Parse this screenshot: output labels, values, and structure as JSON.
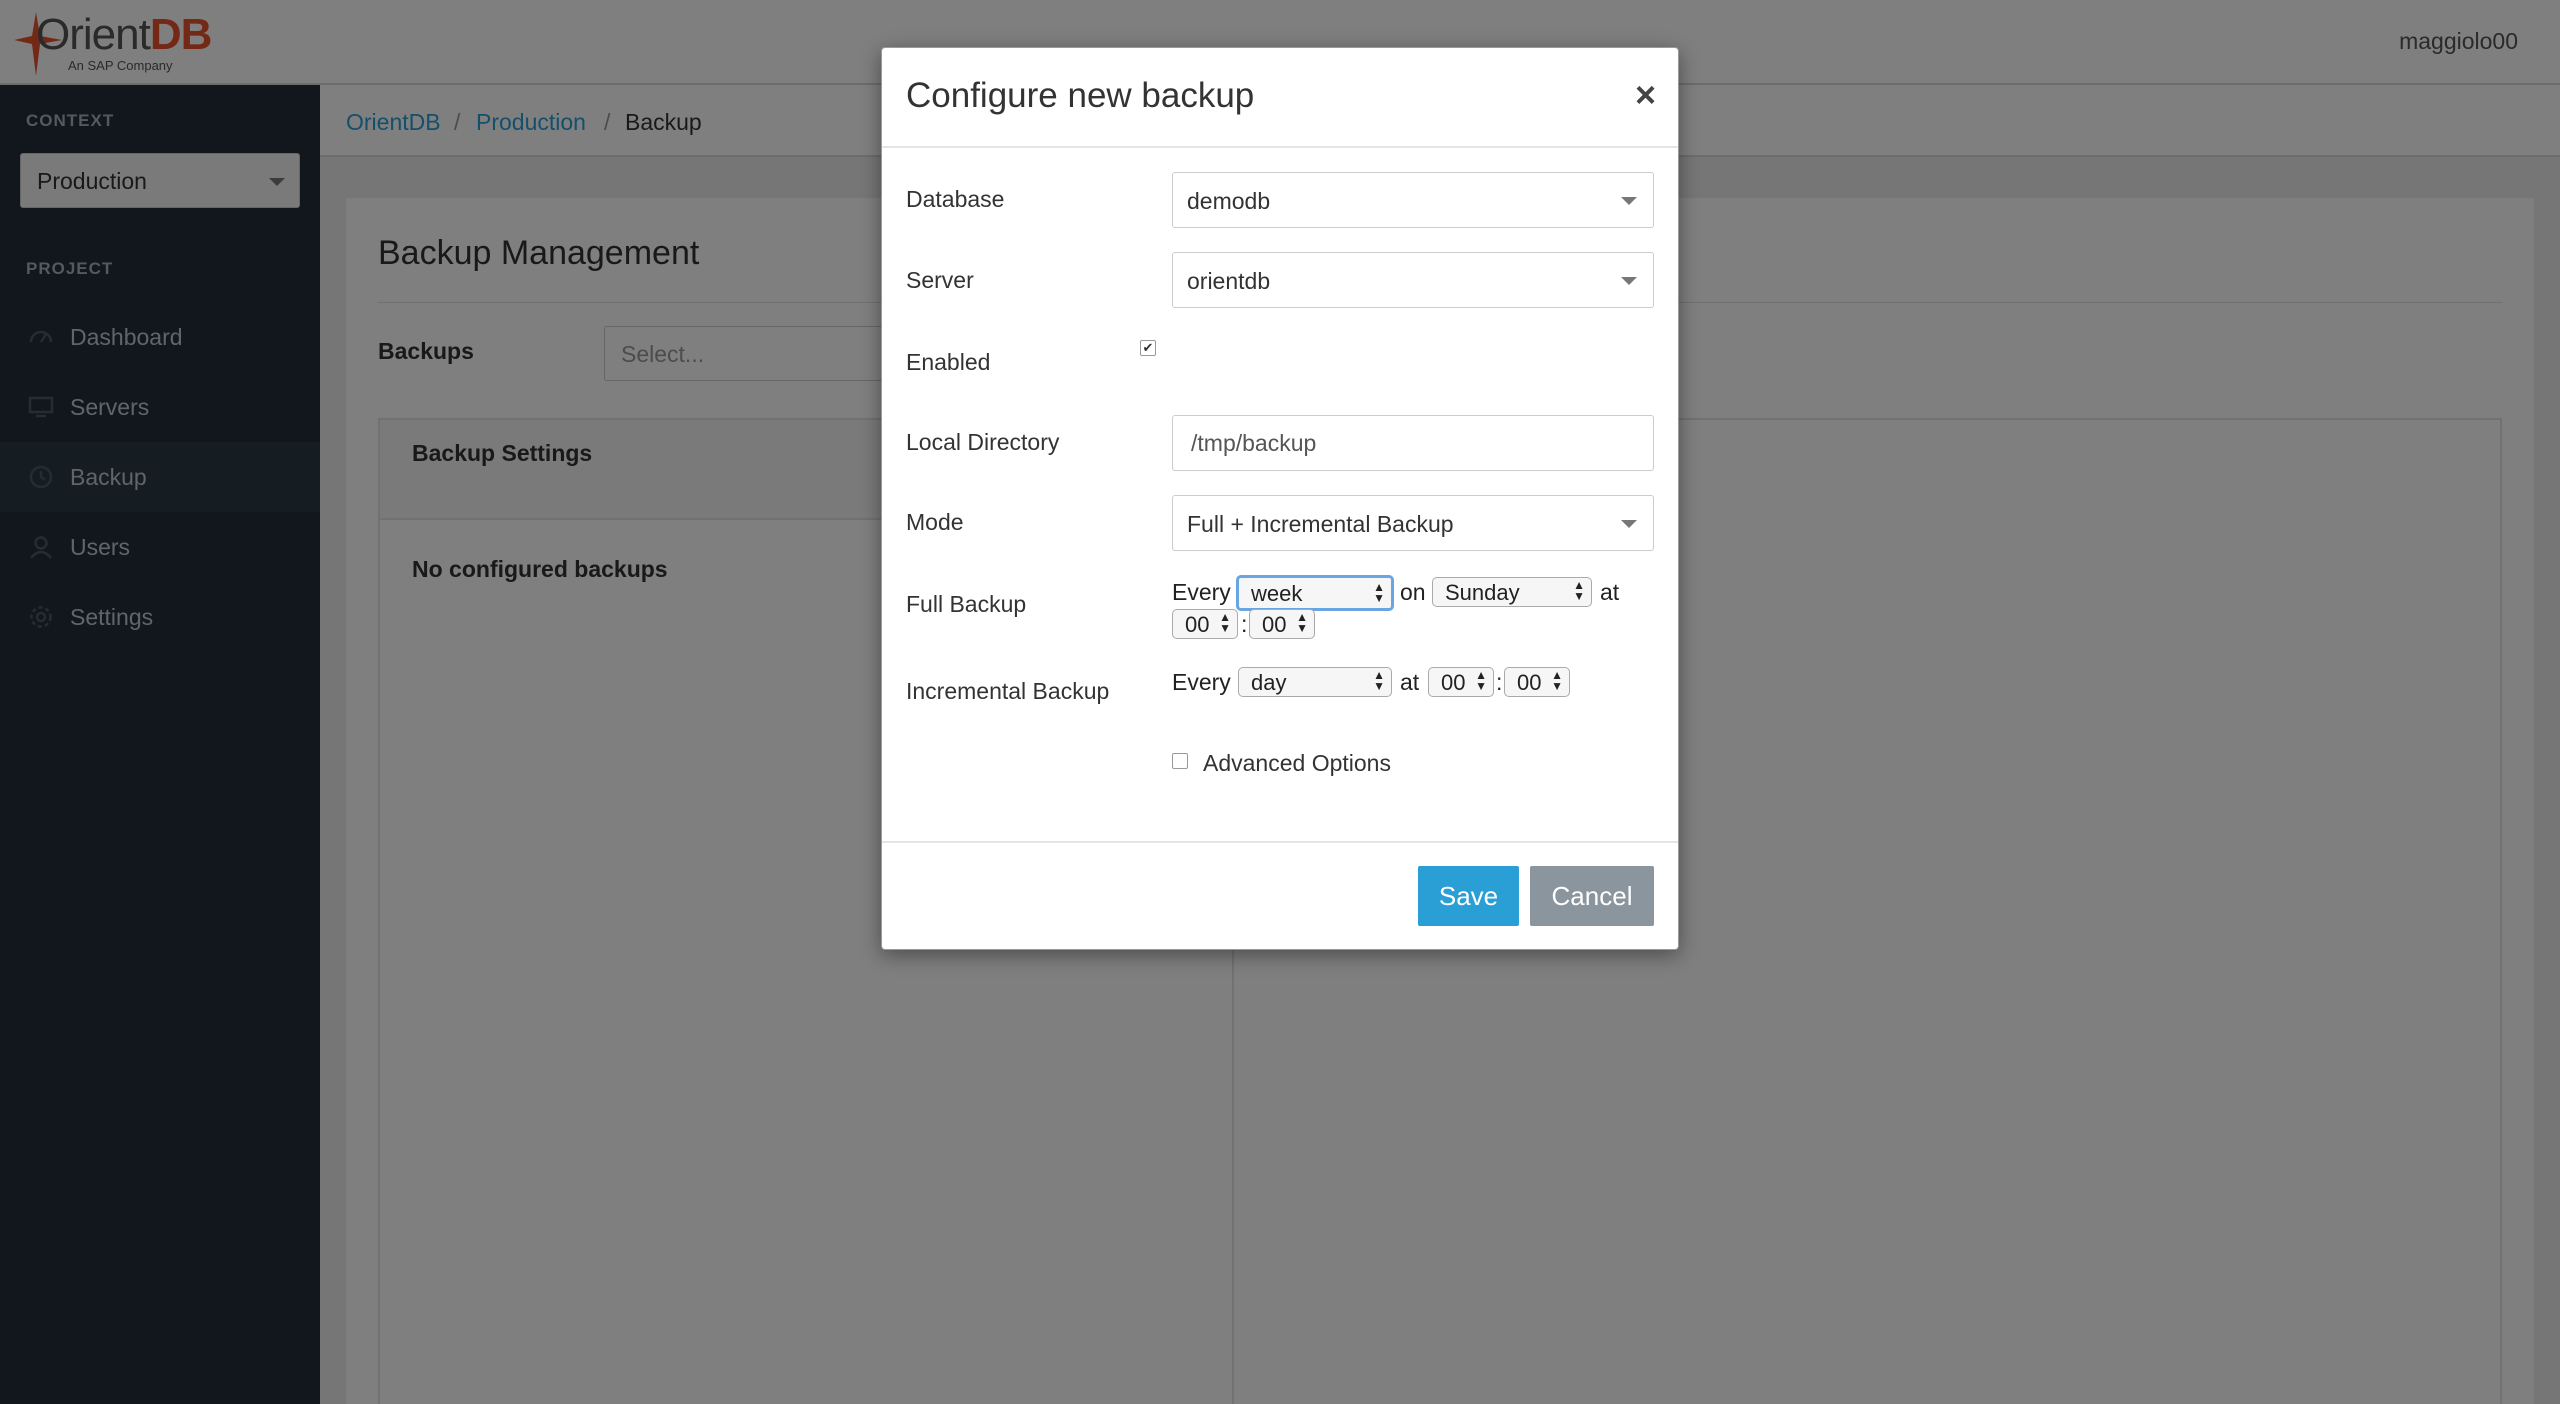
{
  "header": {
    "logo_text_orient": "Orient",
    "logo_text_db": "DB",
    "logo_sub": "An SAP Company",
    "username": "maggiolo00"
  },
  "sidebar": {
    "context_heading": "CONTEXT",
    "context_value": "Production",
    "project_heading": "PROJECT",
    "items": [
      {
        "label": "Dashboard",
        "icon": "dashboard-icon"
      },
      {
        "label": "Servers",
        "icon": "monitor-icon"
      },
      {
        "label": "Backup",
        "icon": "clock-icon",
        "active": true
      },
      {
        "label": "Users",
        "icon": "user-icon"
      },
      {
        "label": "Settings",
        "icon": "gear-icon"
      }
    ]
  },
  "breadcrumb": {
    "items": [
      "OrientDB",
      "Production",
      "Backup"
    ],
    "separator": "/"
  },
  "main": {
    "title": "Backup Management",
    "backups_label": "Backups",
    "backups_placeholder": "Select...",
    "settings_panel_title": "Backup Settings",
    "empty_message": "No configured backups"
  },
  "modal": {
    "title": "Configure new backup",
    "close_glyph": "×",
    "database_label": "Database",
    "database_value": "demodb",
    "server_label": "Server",
    "server_value": "orientdb",
    "enabled_label": "Enabled",
    "enabled_checked": true,
    "local_dir_label": "Local Directory",
    "local_dir_value": "/tmp/backup",
    "mode_label": "Mode",
    "mode_value": "Full + Incremental Backup",
    "full_backup_label": "Full Backup",
    "full_every_text": "Every",
    "full_every_value": "week",
    "full_on_text": "on",
    "full_day_value": "Sunday",
    "full_at_text": "at",
    "full_hour": "00",
    "full_minute": "00",
    "time_sep": ":",
    "incr_backup_label": "Incremental Backup",
    "incr_every_text": "Every",
    "incr_every_value": "day",
    "incr_at_text": "at",
    "incr_hour": "00",
    "incr_minute": "00",
    "advanced_label": "Advanced Options",
    "save_label": "Save",
    "cancel_label": "Cancel"
  },
  "colors": {
    "accent": "#2a9fd6",
    "sidebar_bg": "#232f3a",
    "logo_red": "#e6522c",
    "cancel_bg": "#8a959e"
  }
}
